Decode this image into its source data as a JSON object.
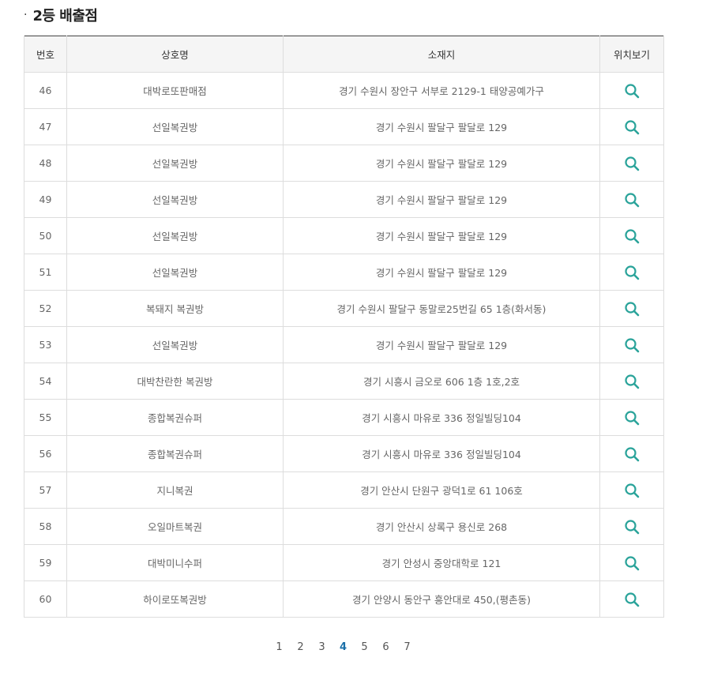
{
  "section": {
    "bullet": "·",
    "title": "2등 배출점"
  },
  "table": {
    "headers": {
      "no": "번호",
      "name": "상호명",
      "address": "소재지",
      "map": "위치보기"
    },
    "rows": [
      {
        "no": "46",
        "name": "대박로또판매점",
        "address": "경기 수원시 장안구 서부로 2129-1 태양공예가구"
      },
      {
        "no": "47",
        "name": "선일복권방",
        "address": "경기 수원시 팔달구 팔달로 129"
      },
      {
        "no": "48",
        "name": "선일복권방",
        "address": "경기 수원시 팔달구 팔달로 129"
      },
      {
        "no": "49",
        "name": "선일복권방",
        "address": "경기 수원시 팔달구 팔달로 129"
      },
      {
        "no": "50",
        "name": "선일복권방",
        "address": "경기 수원시 팔달구 팔달로 129"
      },
      {
        "no": "51",
        "name": "선일복권방",
        "address": "경기 수원시 팔달구 팔달로 129"
      },
      {
        "no": "52",
        "name": "복돼지 복권방",
        "address": "경기 수원시 팔달구 동말로25번길 65 1층(화서동)"
      },
      {
        "no": "53",
        "name": "선일복권방",
        "address": "경기 수원시 팔달구 팔달로 129"
      },
      {
        "no": "54",
        "name": "대박찬란한 복권방",
        "address": "경기 시흥시 금오로 606 1층 1호,2호"
      },
      {
        "no": "55",
        "name": "종합복권슈퍼",
        "address": "경기 시흥시 마유로 336 정일빌딩104"
      },
      {
        "no": "56",
        "name": "종합복권슈퍼",
        "address": "경기 시흥시 마유로 336 정일빌딩104"
      },
      {
        "no": "57",
        "name": "지니복권",
        "address": "경기 안산시 단원구 광덕1로 61 106호"
      },
      {
        "no": "58",
        "name": "오일마트복권",
        "address": "경기 안산시 상록구 용신로 268"
      },
      {
        "no": "59",
        "name": "대박미니수퍼",
        "address": "경기 안성시 중앙대학로 121"
      },
      {
        "no": "60",
        "name": "하이로또복권방",
        "address": "경기 안양시 동안구 흥안대로 450,(평촌동)"
      }
    ],
    "map_icon": "search-icon"
  },
  "pagination": {
    "pages": [
      "1",
      "2",
      "3",
      "4",
      "5",
      "6",
      "7"
    ],
    "current": "4"
  },
  "colors": {
    "accent": "#2aa39a",
    "active_page": "#1a6fa8",
    "header_bg": "#f5f5f5",
    "border": "#dddddd"
  }
}
